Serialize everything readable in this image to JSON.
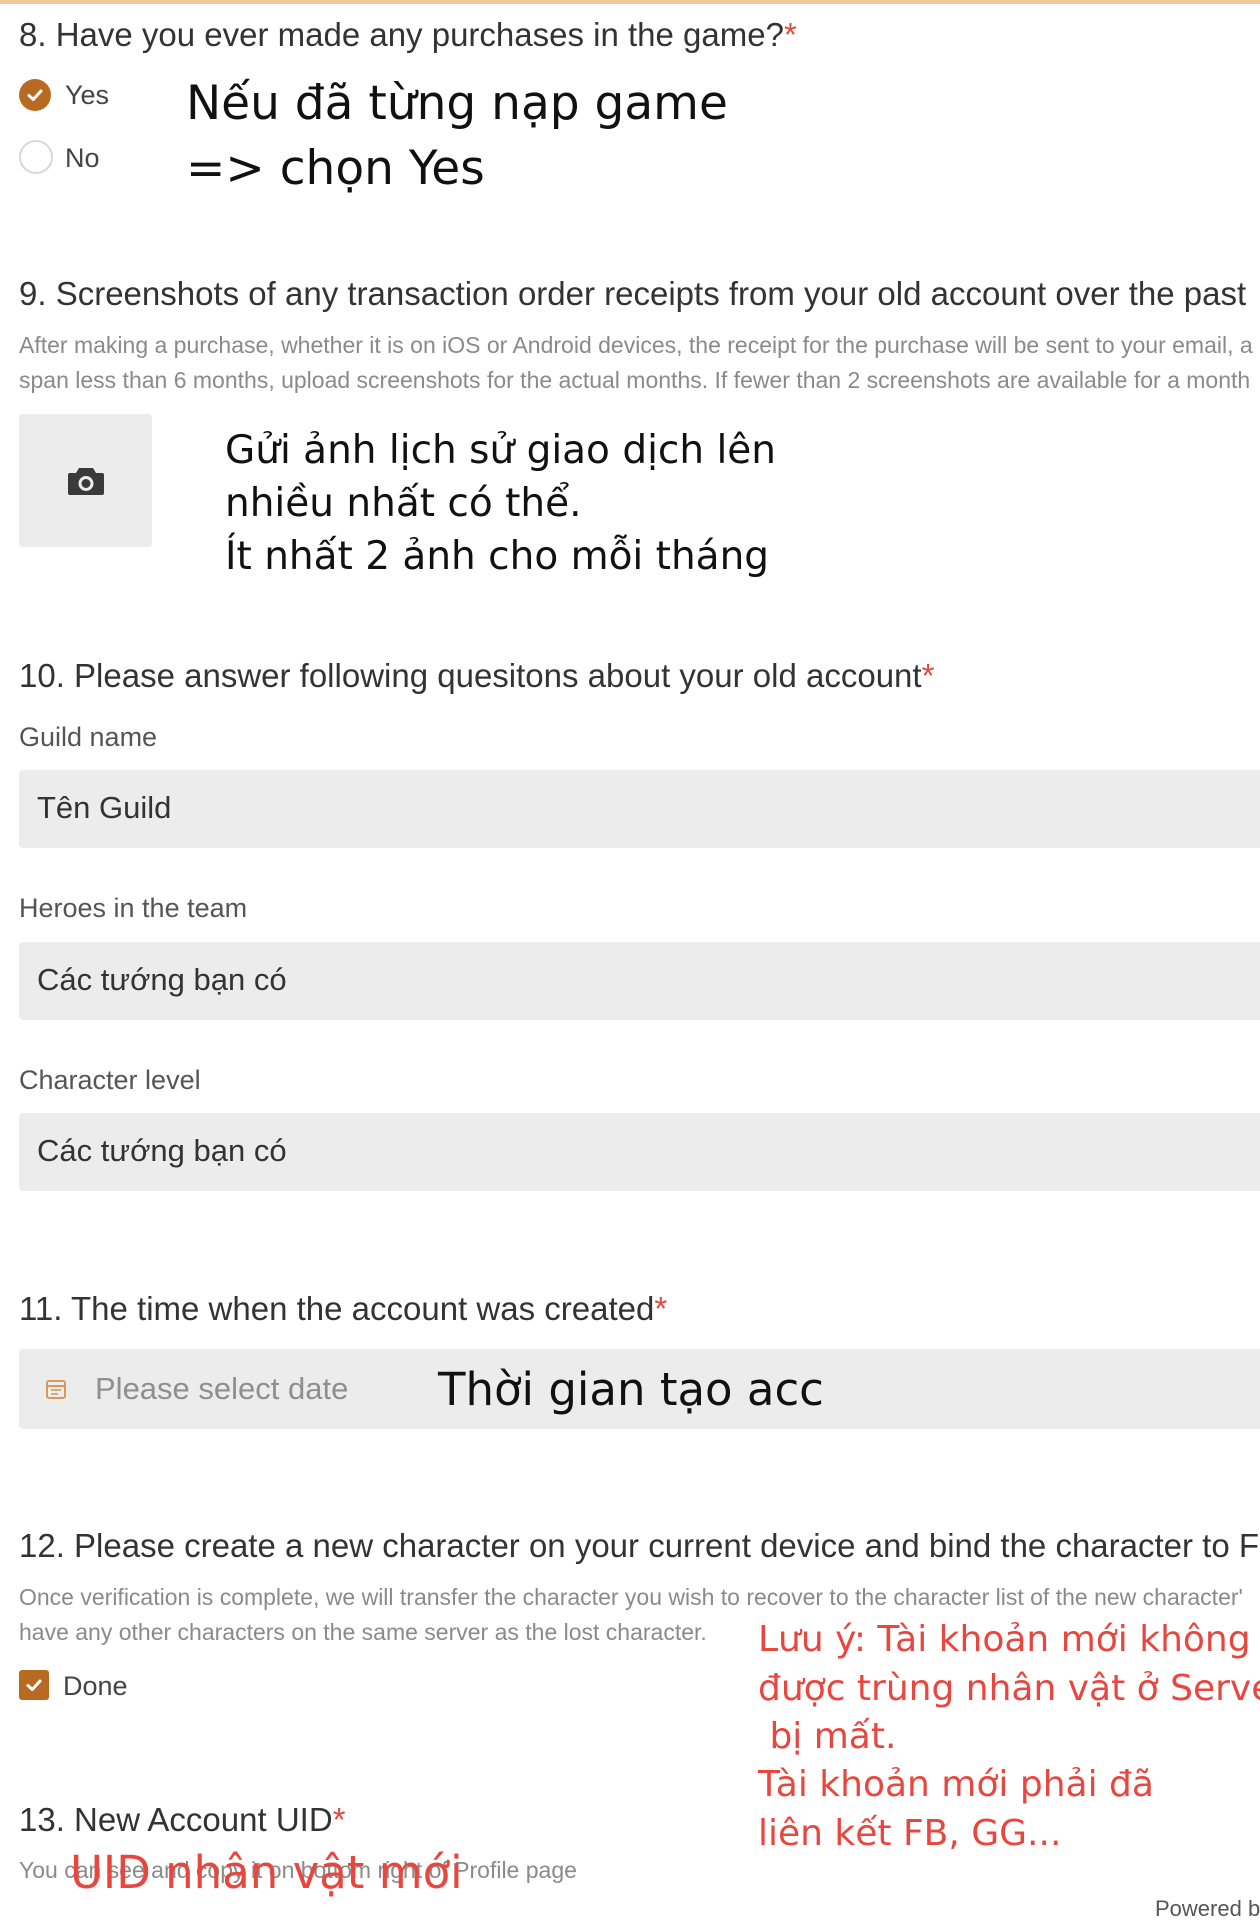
{
  "q8": {
    "title": "8. Have you ever made any purchases in the game?",
    "required": "*",
    "options": [
      "Yes",
      "No"
    ],
    "selected": "Yes",
    "note_line1": "Nếu đã từng nạp game",
    "note_line2": "=> chọn Yes"
  },
  "q9": {
    "title": "9. Screenshots of any transaction order receipts from your old account over the past",
    "desc_line1": "After making a purchase, whether it is on iOS or Android devices, the receipt for the purchase will be sent to your email, a",
    "desc_line2": "span less than 6 months, upload screenshots for the actual months. If fewer than 2 screenshots are available for a month",
    "upload_icon": "camera-icon",
    "note_line1": "Gửi ảnh lịch sử giao dịch lên",
    "note_line2": "nhiều nhất có thể.",
    "note_line3": "Ít nhất 2 ảnh cho mỗi tháng"
  },
  "q10": {
    "title": "10. Please answer following quesitons about your old account",
    "required": "*",
    "guild_label": "Guild name",
    "guild_value": "Tên Guild",
    "heroes_label": "Heroes in the team",
    "heroes_value": "Các tướng bạn có",
    "level_label": "Character level",
    "level_value": "Các tướng bạn có"
  },
  "q11": {
    "title": "11. The time when the account was created",
    "required": "*",
    "placeholder": "Please select date",
    "icon": "calendar-icon",
    "note": "Thời gian tạo acc"
  },
  "q12": {
    "title": "12. Please create a new character on your current device and bind the character to F",
    "desc_line1": "Once verification is complete, we will transfer the character you wish to recover to the character list of the new character'",
    "desc_line2": "have any other characters on the same server as the lost character.",
    "checkbox_label": "Done",
    "checked": true,
    "note_line1": "Lưu ý: Tài khoản mới không",
    "note_line2": "được trùng nhân vật ở Server",
    "note_line3": " bị mất.",
    "note_line4": "Tài khoản mới phải đã",
    "note_line5": "liên kết FB, GG..."
  },
  "q13": {
    "title": "13. New Account UID",
    "required": "*",
    "desc": "You can see and copy it on bottom right of Profile page",
    "note": "UID nhân vật mới"
  },
  "footer": {
    "powered": "Powered b"
  },
  "colors": {
    "accent": "#b86a22",
    "required": "#e0483c",
    "note_red": "#e8473f",
    "field_bg": "#ececec"
  }
}
